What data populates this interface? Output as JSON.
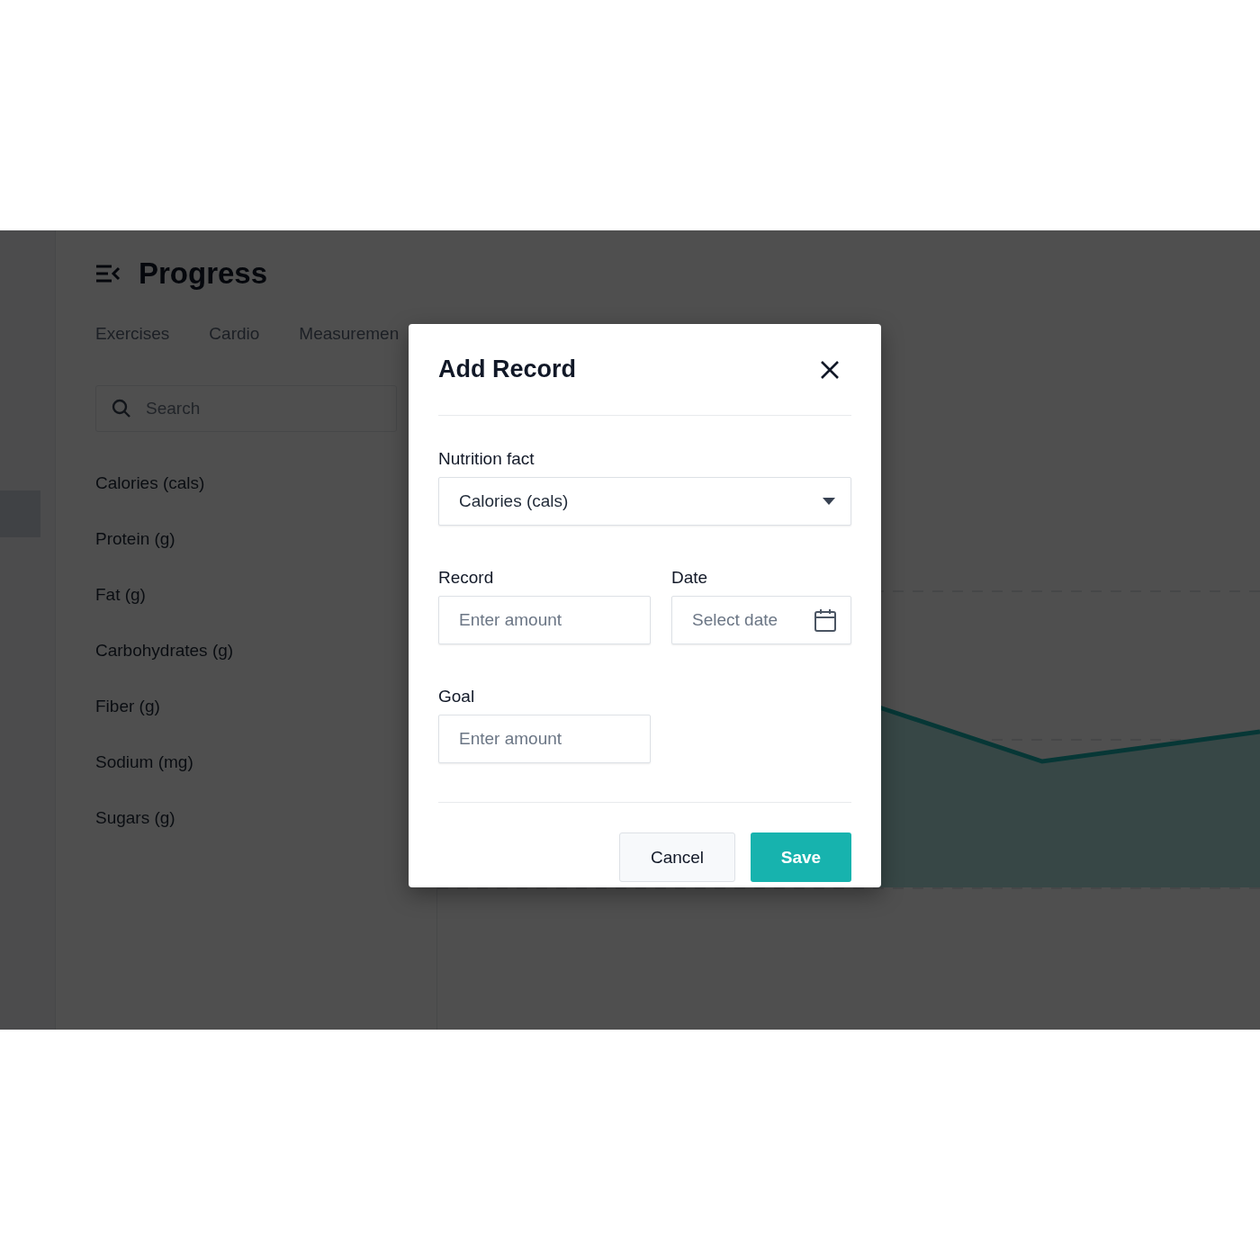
{
  "app": {
    "title": "Progress",
    "tabs": [
      {
        "label": "Exercises"
      },
      {
        "label": "Cardio"
      },
      {
        "label": "Measuremen"
      }
    ],
    "search": {
      "placeholder": "Search"
    },
    "nutrition_list": [
      {
        "label": "Calories (cals)"
      },
      {
        "label": "Protein (g)"
      },
      {
        "label": "Fat (g)"
      },
      {
        "label": "Carbohydrates (g)"
      },
      {
        "label": "Fiber (g)"
      },
      {
        "label": "Sodium (mg)"
      },
      {
        "label": "Sugars (g)"
      }
    ]
  },
  "dialog": {
    "title": "Add Record",
    "fields": [
      {
        "kind": "select",
        "label": "Nutrition fact",
        "value": "Calories (cals)"
      },
      {
        "kind": "input",
        "label": "Record",
        "placeholder": "Enter amount"
      },
      {
        "kind": "date",
        "label": "Date",
        "placeholder": "Select date"
      },
      {
        "kind": "input",
        "label": "Goal",
        "placeholder": "Enter amount"
      }
    ],
    "buttons": [
      {
        "kind": "secondary",
        "label": "Cancel"
      },
      {
        "kind": "primary",
        "label": "Save"
      }
    ]
  }
}
